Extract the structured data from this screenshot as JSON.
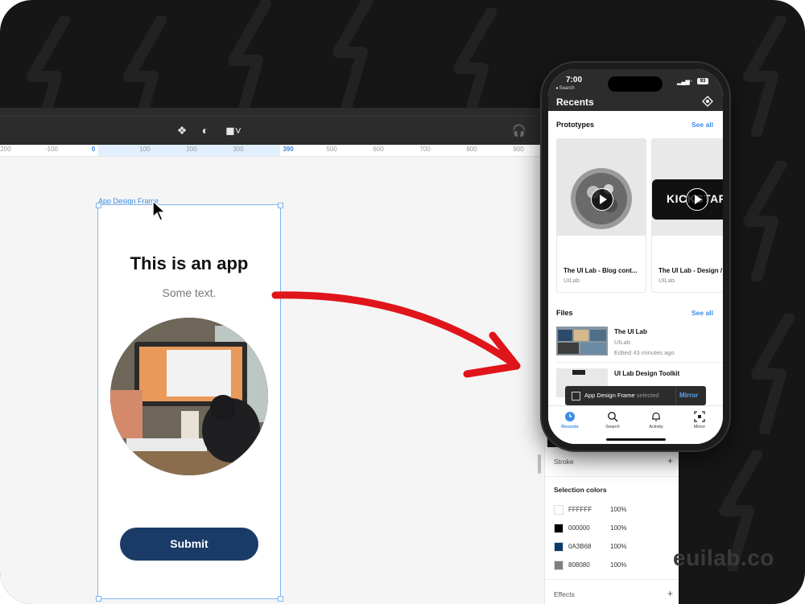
{
  "toolbar": {
    "icons": [
      "component-icon",
      "contrast-icon",
      "boolean-icon",
      "headphones-icon"
    ]
  },
  "ruler": {
    "ticks": [
      "200",
      "-100",
      "0",
      "100",
      "200",
      "300",
      "390",
      "500",
      "600",
      "700",
      "800",
      "900"
    ]
  },
  "canvas": {
    "frame_label": "App Design Frame",
    "app_title": "This is an app",
    "app_subtitle": "Some text.",
    "submit_label": "Submit"
  },
  "panel": {
    "stroke_label": "Stroke",
    "selection_colors_label": "Selection colors",
    "colors": [
      {
        "hex": "FFFFFF",
        "pct": "100%",
        "color": "#FFFFFF"
      },
      {
        "hex": "000000",
        "pct": "100%",
        "color": "#000000"
      },
      {
        "hex": "0A3B68",
        "pct": "100%",
        "color": "#0A3B68"
      },
      {
        "hex": "808080",
        "pct": "100%",
        "color": "#808080"
      }
    ],
    "effects_label": "Effects",
    "add_symbol": "+"
  },
  "watermark": "euilab.co",
  "phone": {
    "time": "7:00",
    "back_label": "◂ Search",
    "battery": "93",
    "header_title": "Recents",
    "prototypes_label": "Prototypes",
    "see_all": "See all",
    "prototypes": [
      {
        "title": "The UI Lab - Blog cont...",
        "owner": "UILab"
      },
      {
        "title": "The UI Lab - Design /",
        "owner": "UILab",
        "thumb_text": "KICKSTART"
      }
    ],
    "files_label": "Files",
    "files": [
      {
        "name": "The UI Lab",
        "owner": "UILab",
        "edited": "Edited 43 minutes ago"
      },
      {
        "name": "UI Lab Design Toolkit"
      }
    ],
    "toast": {
      "frame": "App Design Frame",
      "status": "selected",
      "action": "Mirror"
    },
    "tabs": [
      "Recents",
      "Search",
      "Activity",
      "Mirror"
    ]
  }
}
